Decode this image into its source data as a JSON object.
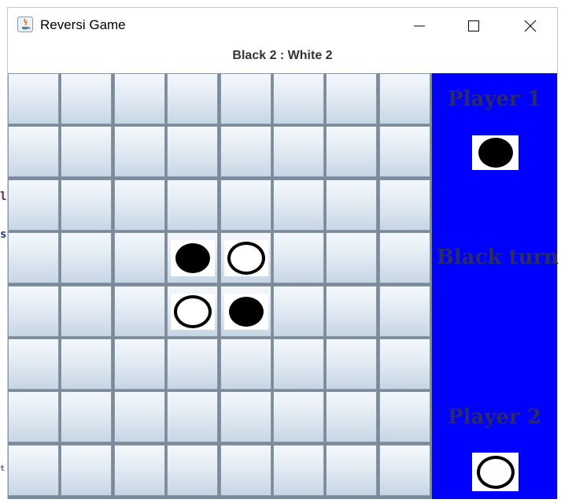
{
  "window": {
    "title": "Reversi Game",
    "controls": [
      "minimize",
      "maximize",
      "close"
    ]
  },
  "score": {
    "text": "Black 2 : White 2",
    "black": 2,
    "white": 2
  },
  "board": {
    "size": 8,
    "pieces": [
      {
        "row": 3,
        "col": 3,
        "color": "black"
      },
      {
        "row": 3,
        "col": 4,
        "color": "white"
      },
      {
        "row": 4,
        "col": 3,
        "color": "white"
      },
      {
        "row": 4,
        "col": 4,
        "color": "black"
      }
    ]
  },
  "side_panel": {
    "player1_label": "Player 1",
    "player1_piece": "black",
    "turn_label": "Black turn",
    "player2_label": "Player 2",
    "player2_piece": "white",
    "background": "#0000ff"
  },
  "background_fragments": [
    "l",
    "s",
    "t"
  ]
}
